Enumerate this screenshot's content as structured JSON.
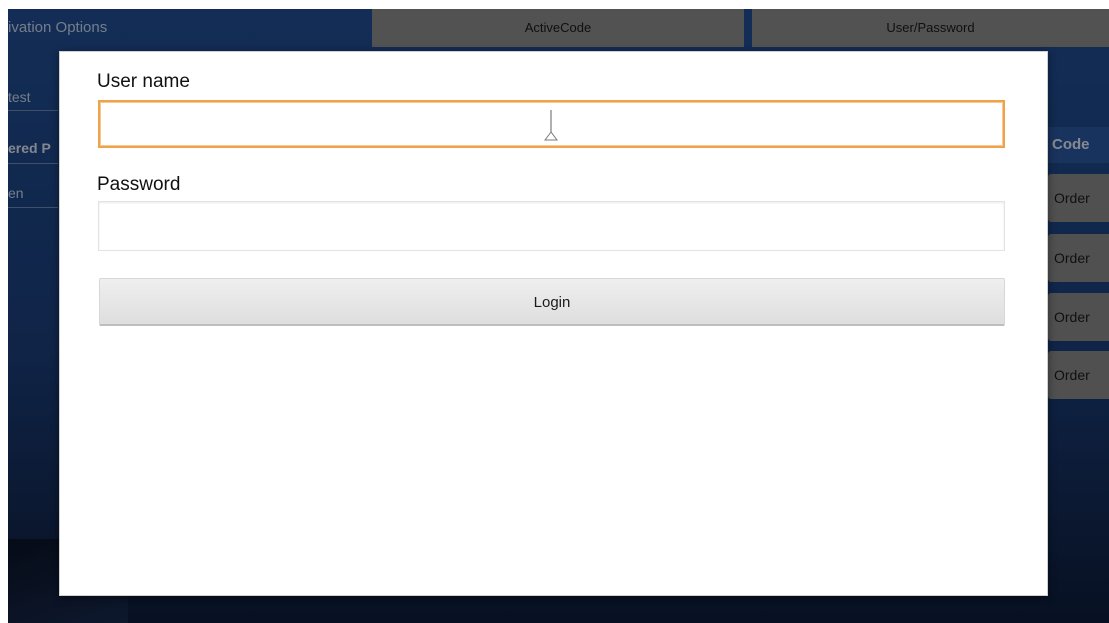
{
  "background": {
    "header_title": "ivation Options",
    "tabs": [
      "ActiveCode",
      "User/Password"
    ],
    "sidebar": [
      "test",
      "ered P",
      "en"
    ],
    "right_header": "Code",
    "order_buttons": [
      "Order",
      "Order",
      "Order",
      "Order"
    ]
  },
  "dialog": {
    "username_label": "User name",
    "username_value": "",
    "password_label": "Password",
    "password_value": "",
    "login_label": "Login"
  },
  "colors": {
    "focus_border": "#f0a24a",
    "background_blue": "#214f95",
    "tab_gray": "#8d8d8d"
  }
}
